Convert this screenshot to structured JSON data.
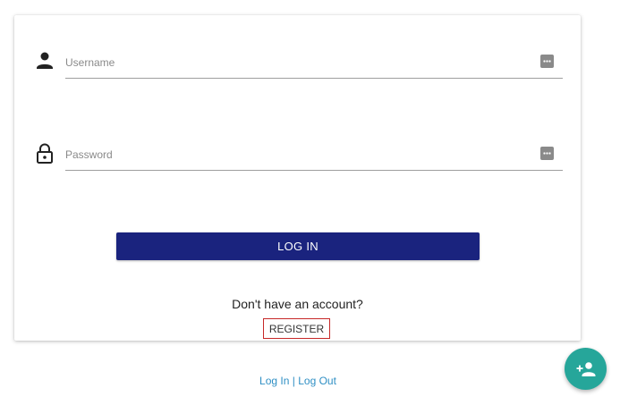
{
  "login_form": {
    "username": {
      "placeholder": "Username",
      "value": "",
      "icon": "person-icon"
    },
    "password": {
      "placeholder": "Password",
      "value": "",
      "icon": "lock-icon"
    },
    "login_label": "LOG IN",
    "signup_prompt": "Don't have an account?",
    "register_label": "REGISTER"
  },
  "footer": {
    "login_link": "Log In",
    "separator": "|",
    "logout_link": "Log Out"
  },
  "fab": {
    "icon": "add-person-icon"
  },
  "colors": {
    "primary_button": "#1a237e",
    "fab": "#26a69a",
    "link": "#2f8fc4",
    "register_border": "#c62828"
  }
}
